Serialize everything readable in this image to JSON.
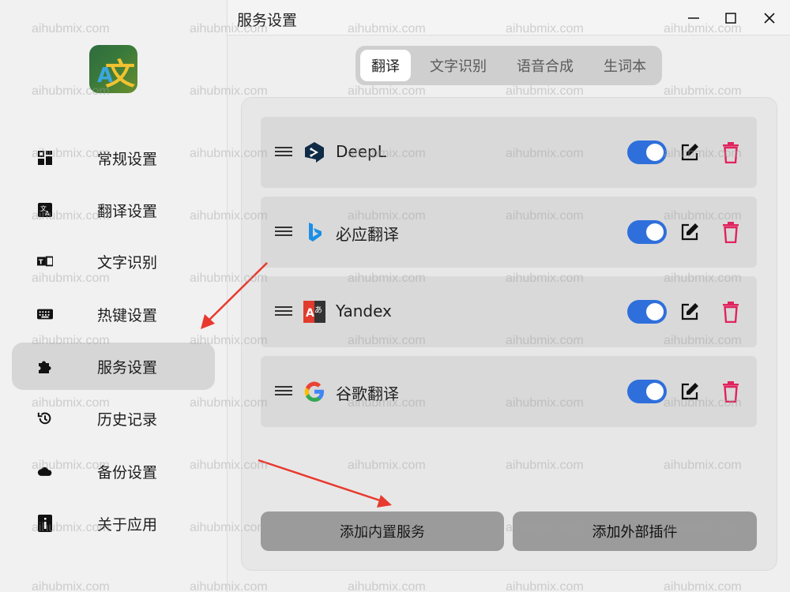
{
  "window": {
    "title": "服务设置",
    "controls": [
      "minimize-icon",
      "maximize-icon",
      "close-icon"
    ]
  },
  "sidebar": {
    "logo": {
      "glyph_latin": "A",
      "glyph_cjk": "文"
    },
    "items": [
      {
        "label": "常规设置",
        "icon": "grid-icon",
        "active": false
      },
      {
        "label": "翻译设置",
        "icon": "translate-icon",
        "active": false
      },
      {
        "label": "文字识别",
        "icon": "ocr-icon",
        "active": false
      },
      {
        "label": "热键设置",
        "icon": "keyboard-icon",
        "active": false
      },
      {
        "label": "服务设置",
        "icon": "puzzle-icon",
        "active": true
      },
      {
        "label": "历史记录",
        "icon": "history-icon",
        "active": false
      },
      {
        "label": "备份设置",
        "icon": "cloud-icon",
        "active": false
      },
      {
        "label": "关于应用",
        "icon": "info-icon",
        "active": false
      }
    ]
  },
  "tabs": [
    {
      "label": "翻译",
      "active": true
    },
    {
      "label": "文字识别",
      "active": false
    },
    {
      "label": "语音合成",
      "active": false
    },
    {
      "label": "生词本",
      "active": false
    }
  ],
  "services": [
    {
      "name": "DeepL",
      "icon": "deepl-logo-icon",
      "enabled": true
    },
    {
      "name": "必应翻译",
      "icon": "bing-logo-icon",
      "enabled": true
    },
    {
      "name": "Yandex",
      "icon": "yandex-logo-icon",
      "enabled": true
    },
    {
      "name": "谷歌翻译",
      "icon": "google-logo-icon",
      "enabled": true
    }
  ],
  "actions": {
    "add_builtin": "添加内置服务",
    "add_external": "添加外部插件"
  },
  "watermark": "aihubmix.com",
  "colors": {
    "toggle_on": "#2f6fdc",
    "delete": "#e0245e",
    "active_nav_bg": "#d6d6d6",
    "annotation_arrow": "#e8392e"
  }
}
